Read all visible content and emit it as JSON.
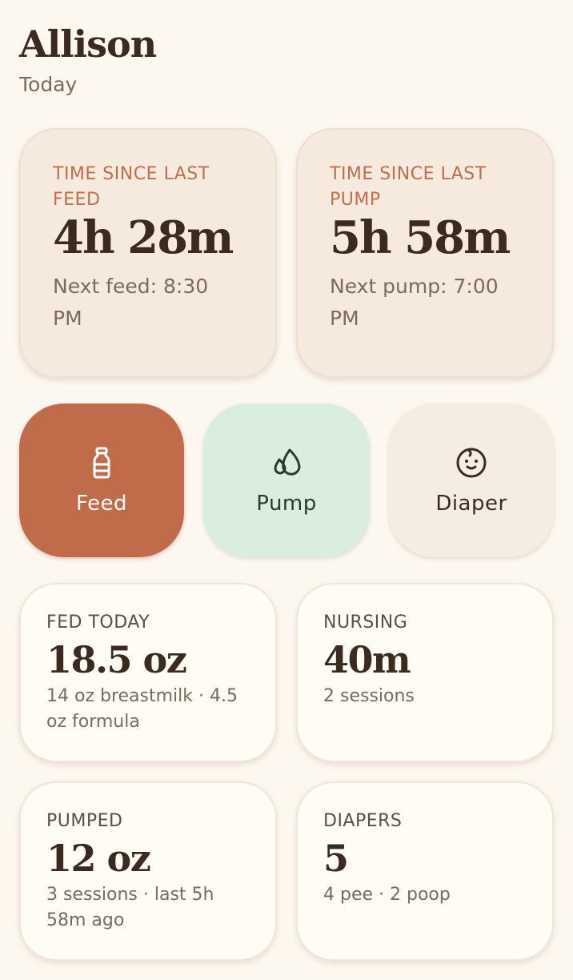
{
  "header": {
    "name": "Allison",
    "day": "Today"
  },
  "timers": {
    "feed": {
      "label": "TIME SINCE LAST FEED",
      "value": "4h 28m",
      "next": "Next feed: 8:30 PM"
    },
    "pump": {
      "label": "TIME SINCE LAST PUMP",
      "value": "5h 58m",
      "next": "Next pump: 7:00 PM"
    }
  },
  "actions": {
    "feed": {
      "label": "Feed",
      "icon": "bottle-icon",
      "color": "#c06c4a"
    },
    "pump": {
      "label": "Pump",
      "icon": "drops-icon",
      "color": "#d9eedc"
    },
    "diaper": {
      "label": "Diaper",
      "icon": "baby-face-icon",
      "color": "#f5ede2"
    }
  },
  "stats": {
    "fed": {
      "label": "FED TODAY",
      "value": "18.5 oz",
      "sub": "14 oz breastmilk · 4.5 oz formula"
    },
    "nursing": {
      "label": "NURSING",
      "value": "40m",
      "sub": "2 sessions"
    },
    "pumped": {
      "label": "PUMPED",
      "value": "12 oz",
      "sub": "3 sessions · last 5h 58m ago"
    },
    "diapers": {
      "label": "DIAPERS",
      "value": "5",
      "sub": "4 pee · 2 poop"
    }
  }
}
